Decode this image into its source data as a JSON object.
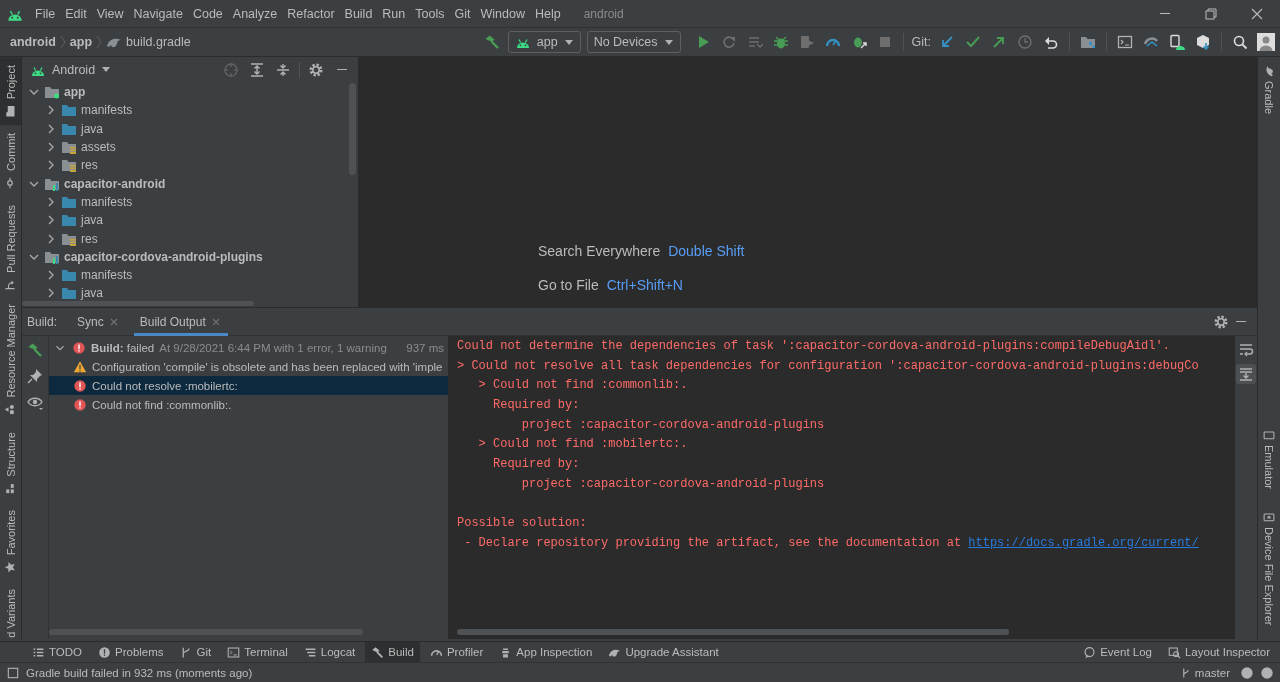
{
  "menu_bar": {
    "menus": [
      "File",
      "Edit",
      "View",
      "Navigate",
      "Code",
      "Analyze",
      "Refactor",
      "Build",
      "Run",
      "Tools",
      "Git",
      "Window",
      "Help"
    ],
    "project_name": "android"
  },
  "breadcrumbs": [
    "android",
    "app",
    "build.gradle"
  ],
  "toolbar": {
    "run_config": "app",
    "device": "No Devices",
    "git_label": "Git:"
  },
  "left_tool_strip": {
    "top": [
      {
        "label": "Project",
        "selected": true
      },
      {
        "label": "Commit",
        "selected": false
      },
      {
        "label": "Pull Requests",
        "selected": false
      }
    ],
    "bottom": [
      {
        "label": "Resource Manager",
        "selected": false
      },
      {
        "label": "Structure",
        "selected": false
      },
      {
        "label": "Favorites",
        "selected": false
      },
      {
        "label": "d Variants",
        "selected": false
      }
    ]
  },
  "right_tool_strip": {
    "top": [
      {
        "label": "Gradle",
        "selected": false
      }
    ],
    "bottom": [
      {
        "label": "Emulator",
        "selected": false
      },
      {
        "label": "Device File Explorer",
        "selected": false
      }
    ]
  },
  "project_panel": {
    "view": "Android",
    "tree": [
      {
        "label": "app",
        "kind": "app-module",
        "expanded": true,
        "children": [
          {
            "label": "manifests",
            "kind": "folder",
            "expanded": false
          },
          {
            "label": "java",
            "kind": "folder",
            "expanded": false
          },
          {
            "label": "assets",
            "kind": "resource-folder",
            "expanded": false
          },
          {
            "label": "res",
            "kind": "resource-folder",
            "expanded": false
          }
        ]
      },
      {
        "label": "capacitor-android",
        "kind": "library-module",
        "expanded": true,
        "children": [
          {
            "label": "manifests",
            "kind": "folder",
            "expanded": false
          },
          {
            "label": "java",
            "kind": "folder",
            "expanded": false
          },
          {
            "label": "res",
            "kind": "resource-folder",
            "expanded": false
          }
        ]
      },
      {
        "label": "capacitor-cordova-android-plugins",
        "kind": "library-module",
        "expanded": true,
        "children": [
          {
            "label": "manifests",
            "kind": "folder",
            "expanded": false
          },
          {
            "label": "java",
            "kind": "folder",
            "expanded": false
          }
        ]
      }
    ]
  },
  "editor_hints": [
    {
      "label": "Search Everywhere",
      "shortcut": "Double Shift"
    },
    {
      "label": "Go to File",
      "shortcut": "Ctrl+Shift+N"
    }
  ],
  "build_panel": {
    "title": "Build:",
    "tabs": [
      {
        "label": "Sync",
        "selected": false
      },
      {
        "label": "Build Output",
        "selected": true
      }
    ],
    "tree": [
      {
        "kind": "error",
        "label": "**Build:** failed",
        "detail": "At 9/28/2021 6:44 PM with 1 error, 1 warning",
        "time": "937 ms",
        "expanded": true,
        "selected": false,
        "children": [
          {
            "kind": "warning",
            "label": "Configuration 'compile' is obsolete and has been replaced with 'imple",
            "selected": false
          },
          {
            "kind": "error",
            "label": "Could not resolve :mobilertc:",
            "selected": true
          },
          {
            "kind": "error",
            "label": "Could not find :commonlib:.",
            "selected": false
          }
        ]
      }
    ],
    "output": [
      {
        "lines": [
          {
            "text": "Could not determine the dependencies of task ':capacitor-cordova-android-plugins:compileDebugAidl'."
          },
          {
            "text": "> Could not resolve all task dependencies for configuration ':capacitor-cordova-android-plugins:debugCo"
          },
          {
            "text": "   > Could not find :commonlib:."
          },
          {
            "text": "     Required by:"
          },
          {
            "text": "         project :capacitor-cordova-android-plugins"
          },
          {
            "text": "   > Could not find :mobilertc:."
          },
          {
            "text": "     Required by:"
          },
          {
            "text": "         project :capacitor-cordova-android-plugins"
          }
        ]
      },
      {
        "lines": [
          {
            "text": "Possible solution:"
          },
          {
            "text": " - Declare repository providing the artifact, see the documentation at ",
            "link": "https://docs.gradle.org/current/"
          }
        ]
      }
    ]
  },
  "bottom_tools": {
    "left": [
      {
        "label": "TODO",
        "selected": false
      },
      {
        "label": "Problems",
        "selected": false
      },
      {
        "label": "Git",
        "selected": false
      },
      {
        "label": "Terminal",
        "selected": false
      },
      {
        "label": "Logcat",
        "selected": false
      },
      {
        "label": "Build",
        "selected": true
      },
      {
        "label": "Profiler",
        "selected": false
      },
      {
        "label": "App Inspection",
        "selected": false
      },
      {
        "label": "Upgrade Assistant",
        "selected": false
      }
    ],
    "right": [
      {
        "label": "Event Log",
        "selected": false
      },
      {
        "label": "Layout Inspector",
        "selected": false
      }
    ]
  },
  "status_bar": {
    "message": "Gradle build failed in 932 ms (moments ago)",
    "branch": "master"
  }
}
